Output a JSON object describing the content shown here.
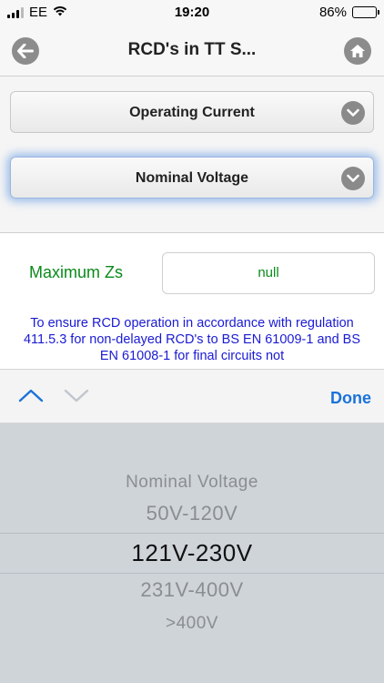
{
  "status_bar": {
    "carrier": "EE",
    "time": "19:20",
    "battery": "86%",
    "battery_level": 0.86
  },
  "nav": {
    "title": "RCD's in TT S..."
  },
  "form": {
    "operating_current_label": "Operating Current",
    "nominal_voltage_label": "Nominal Voltage"
  },
  "result": {
    "max_zs_label": "Maximum Zs",
    "max_zs_value": "null",
    "note": "To ensure RCD operation in accordance with regulation 411.5.3 for non-delayed RCD's to BS EN 61009-1 and BS EN 61008-1 for final circuits not"
  },
  "toolbar": {
    "done_label": "Done"
  },
  "picker": {
    "options": [
      "Nominal Voltage",
      "50V-120V",
      "121V-230V",
      "231V-400V",
      ">400V"
    ],
    "selected": "121V-230V"
  }
}
